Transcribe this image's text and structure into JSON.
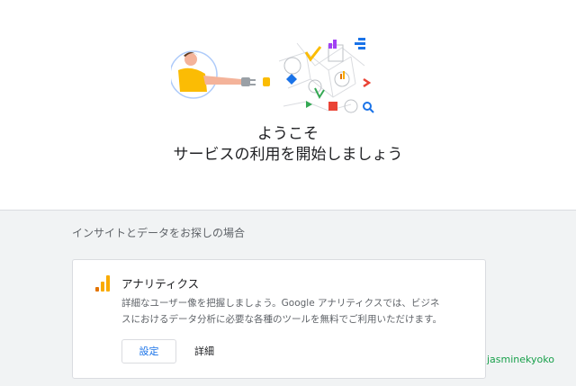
{
  "welcome": {
    "line1": "ようこそ",
    "line2": "サービスの利用を開始しましょう"
  },
  "section": {
    "title": "インサイトとデータをお探しの場合"
  },
  "card": {
    "icon": "analytics-bar-icon",
    "title": "アナリティクス",
    "desc1": "詳細なユーザー像を把握しましょう。Google アナリティクスでは、ビジネ",
    "desc2": "スにおけるデータ分析に必要な各種のツールを無料でご利用いただけます。",
    "setup_label": "設定",
    "details_label": "詳細"
  },
  "watermark": "jasminekyoko",
  "colors": {
    "accent_blue": "#1a73e8",
    "analytics_orange": "#f9ab00",
    "analytics_dark_orange": "#e37400",
    "watermark_green": "#19a04b"
  }
}
